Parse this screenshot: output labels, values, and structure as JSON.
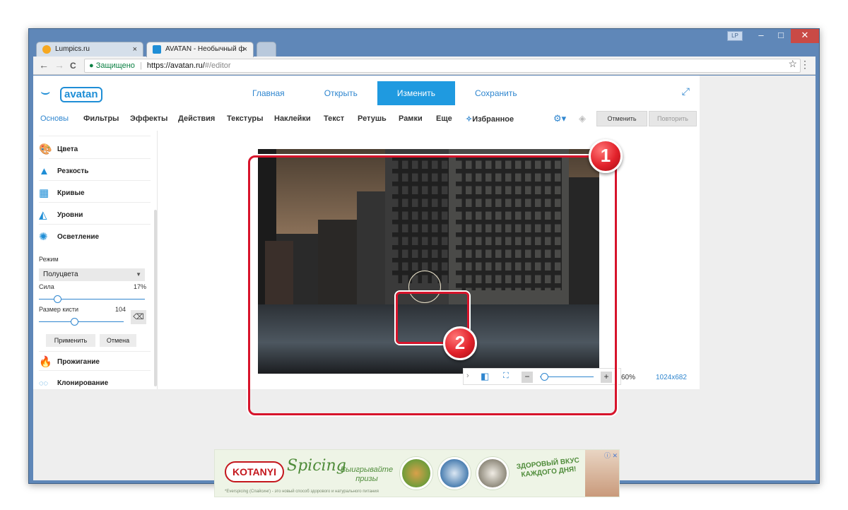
{
  "browser": {
    "tabs": [
      {
        "title": "Lumpics.ru",
        "close": "×",
        "favicon_color": "#f6a821"
      },
      {
        "title": "AVATAN - Необычный ф",
        "close": "×",
        "favicon_color": "#1f8ed6"
      }
    ],
    "profile": "LP",
    "window_controls": {
      "minimize": "–",
      "maximize": "□",
      "close": "✕"
    },
    "nav": {
      "back": "←",
      "forward": "→",
      "reload": "C"
    },
    "address": {
      "lock": "🔒",
      "secure_label": "Защищено",
      "separator": "|",
      "host": "https://avatan.ru/",
      "path": "#/editor"
    },
    "star": "☆",
    "menu": "⋮"
  },
  "app": {
    "logo": {
      "whale": "⌣",
      "text": "avatan"
    },
    "topnav": [
      {
        "label": "Главная",
        "active": false
      },
      {
        "label": "Открыть",
        "active": false
      },
      {
        "label": "Изменить",
        "active": true
      },
      {
        "label": "Сохранить",
        "active": false
      }
    ],
    "fullscreen_icon": "⤢",
    "tools": [
      {
        "label": "Основы",
        "active": true
      },
      {
        "label": "Фильтры"
      },
      {
        "label": "Эффекты"
      },
      {
        "label": "Действия"
      },
      {
        "label": "Текстуры"
      },
      {
        "label": "Наклейки"
      },
      {
        "label": "Текст"
      },
      {
        "label": "Ретушь"
      },
      {
        "label": "Рамки"
      },
      {
        "label": "Еще"
      },
      {
        "label": "Избранное",
        "icon": "✧"
      }
    ],
    "settings_icon": "⚙▾",
    "layers_icon": "◈",
    "undo_label": "Отменить",
    "redo_label": "Повторить",
    "sidebar": {
      "items": [
        {
          "label": "Цвета",
          "icon": "🎨"
        },
        {
          "label": "Резкость",
          "icon": "▲"
        },
        {
          "label": "Кривые",
          "icon": "▦"
        },
        {
          "label": "Уровни",
          "icon": "◭"
        },
        {
          "label": "Осветление",
          "icon": "✺"
        }
      ],
      "panel": {
        "mode_label": "Режим",
        "mode_value": "Полуцвета",
        "strength_label": "Сила",
        "strength_value": "17%",
        "strength_fraction": 0.17,
        "brush_label": "Размер кисти",
        "brush_value": "104",
        "brush_fraction": 0.42,
        "eraser_icon": "⌫",
        "apply_label": "Применить",
        "cancel_label": "Отмена"
      },
      "more_items": [
        {
          "label": "Прожигание",
          "icon": "🔥"
        },
        {
          "label": "Клонирование",
          "icon": "◌◌"
        }
      ]
    },
    "zoom": {
      "expand": "›",
      "compare_icon": "◧",
      "fit_icon": "⛶",
      "minus": "−",
      "plus": "+",
      "level": "60%",
      "level_fraction": 0.08,
      "dimensions": "1024x682"
    },
    "callouts": {
      "one": "1",
      "two": "2"
    }
  },
  "ad": {
    "brand": "KOTANYI",
    "script": "Spicing",
    "cta": "Выигрывайте призы",
    "slogan": "ЗДОРОВЫЙ ВКУС КАЖДОГО ДНЯ!",
    "fine_print": "*Everspicing (Спайсинг) - это новый способ здорового и натурального питания",
    "close": "ⓘ ✕"
  },
  "colors": {
    "accent": "#1f9ae0",
    "highlight_red": "#d7142b",
    "link": "#2f86cf"
  }
}
